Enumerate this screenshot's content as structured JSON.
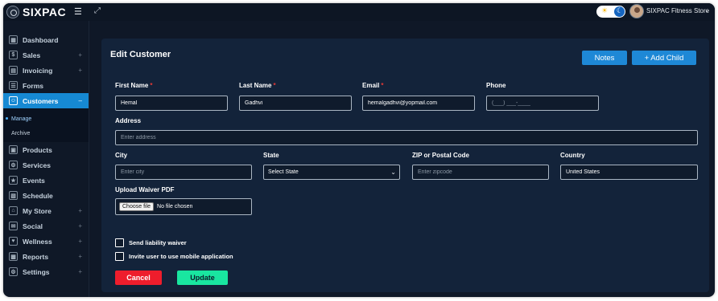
{
  "brand": {
    "name": "SIXPAC"
  },
  "topbar": {
    "menu_icon": "hamburger-icon",
    "expand_icon": "fullscreen-icon",
    "store_name": "SIXPAC Fitness Store"
  },
  "sidebar": {
    "items": [
      {
        "label": "Dashboard",
        "icon": "dashboard-icon",
        "has_plus": false
      },
      {
        "label": "Sales",
        "icon": "sales-icon",
        "has_plus": true
      },
      {
        "label": "Invoicing",
        "icon": "invoice-icon",
        "has_plus": true
      },
      {
        "label": "Forms",
        "icon": "forms-icon",
        "has_plus": false
      },
      {
        "label": "Customers",
        "icon": "customers-icon",
        "has_plus": true,
        "active": true,
        "sub_items": [
          {
            "label": "Manage",
            "current": true
          },
          {
            "label": "Archive"
          }
        ]
      },
      {
        "label": "Products",
        "icon": "products-icon",
        "has_plus": false
      },
      {
        "label": "Services",
        "icon": "services-icon",
        "has_plus": false
      },
      {
        "label": "Events",
        "icon": "events-icon",
        "has_plus": false
      },
      {
        "label": "Schedule",
        "icon": "schedule-icon",
        "has_plus": false
      },
      {
        "label": "My Store",
        "icon": "store-icon",
        "has_plus": true
      },
      {
        "label": "Social",
        "icon": "social-icon",
        "has_plus": true
      },
      {
        "label": "Wellness",
        "icon": "wellness-icon",
        "has_plus": true
      },
      {
        "label": "Reports",
        "icon": "reports-icon",
        "has_plus": true
      },
      {
        "label": "Settings",
        "icon": "settings-icon",
        "has_plus": true
      }
    ]
  },
  "form": {
    "title": "Edit Customer",
    "notes_label": "Notes",
    "add_child_label": "+ Add Child",
    "first_name": {
      "label": "First Name",
      "value": "Hemal",
      "required": "*"
    },
    "last_name": {
      "label": "Last Name",
      "value": "Gadhvi",
      "required": "*"
    },
    "email": {
      "label": "Email",
      "value": "hemalgadhvi@yopmail.com",
      "required": "*"
    },
    "phone": {
      "label": "Phone",
      "placeholder": "(___) ___-____"
    },
    "address": {
      "label": "Address",
      "placeholder": "Enter address"
    },
    "city": {
      "label": "City",
      "placeholder": "Enter city"
    },
    "state": {
      "label": "State",
      "value": "Select State"
    },
    "zip": {
      "label": "ZIP or Postal Code",
      "placeholder": "Enter zipcode"
    },
    "country": {
      "label": "Country",
      "value": "United States"
    },
    "waiver": {
      "label": "Upload Waiver PDF",
      "button": "Choose file",
      "status": "No file chosen"
    },
    "checkbox_waiver": "Send liability waiver",
    "checkbox_mobile": "Invite user to use mobile application",
    "cancel_label": "Cancel",
    "update_label": "Update"
  },
  "colors": {
    "background": "#0f1827",
    "card": "#13233a",
    "accent": "#1e88d6",
    "danger": "#ee1d2c",
    "success": "#19e6a0"
  }
}
